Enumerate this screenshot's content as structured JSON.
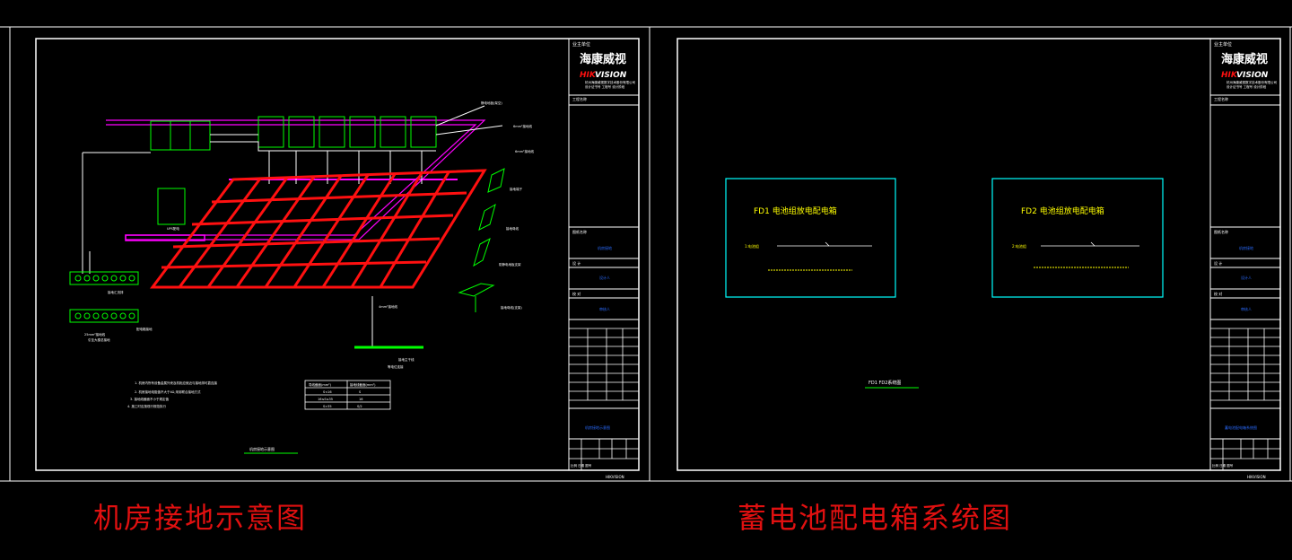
{
  "left_sheet": {
    "header_label": "业主单位",
    "brand_cn": "海康威视",
    "brand_en_red": "HIK",
    "brand_en_white": "VISION",
    "brand_sub1": "杭州海康威视数字技术股份有限公司",
    "brand_sub2": "设计证书号  工程号  设计阶段",
    "project_label": "工程名称",
    "row_labels": [
      "图纸名称",
      "设 计",
      "校 对"
    ],
    "row_values": [
      "机房接地",
      "设计人",
      "审核人"
    ],
    "footer_blue": "机房接地示意图",
    "footer_text": "比例 日期 图号",
    "title_under_drawing": "机房接地示意图",
    "notes": [
      "1. 机房内所有设备金属外壳及机柜应就近与接地排可靠连接",
      "2. 机房接地电阻值不大于4Ω,采用联合接地方式",
      "3. 接地线截面不小于规定值",
      "4. 施工时应按现行规范执行"
    ],
    "table_header": [
      "导线截面(mm²)",
      "接地线截面(mm²)"
    ],
    "table_rows": [
      [
        "S<16",
        "S"
      ],
      [
        "16≤S≤35",
        "16"
      ],
      [
        "S>35",
        "S/2"
      ]
    ],
    "callouts": [
      "静电地板(架空)",
      "6mm²接地线",
      "6mm²接地线",
      "接地端子",
      "接地母线",
      "防静电地板支架",
      "接地母线(支架)",
      "4mm²接地线",
      "接地主干线",
      "等电位连接",
      "25mm²接地线",
      "引至大楼总接地"
    ],
    "ground_bar_label": "接地汇流排",
    "ground_bar2_label": "配电箱接地",
    "ups_label": "UPS配电"
  },
  "right_sheet": {
    "box1_title": "FD1 电池组放电配电箱",
    "box1_line": "1:电池组",
    "box2_title": "FD2 电池组放电配电箱",
    "box2_line": "2:电池组",
    "bottom_label": "FD1 FD2系统图",
    "footer_blue": "蓄电池配电箱系统图"
  },
  "captions": {
    "left": "机房接地示意图",
    "right": "蓄电池配电箱系统图"
  },
  "colors": {
    "white": "#ffffff",
    "green": "#00ff00",
    "red": "#ff1010",
    "magenta": "#ff00ff",
    "cyan": "#00ffff",
    "yellow": "#ffff00",
    "blue": "#2a6bff",
    "caption_red": "#e01010"
  }
}
